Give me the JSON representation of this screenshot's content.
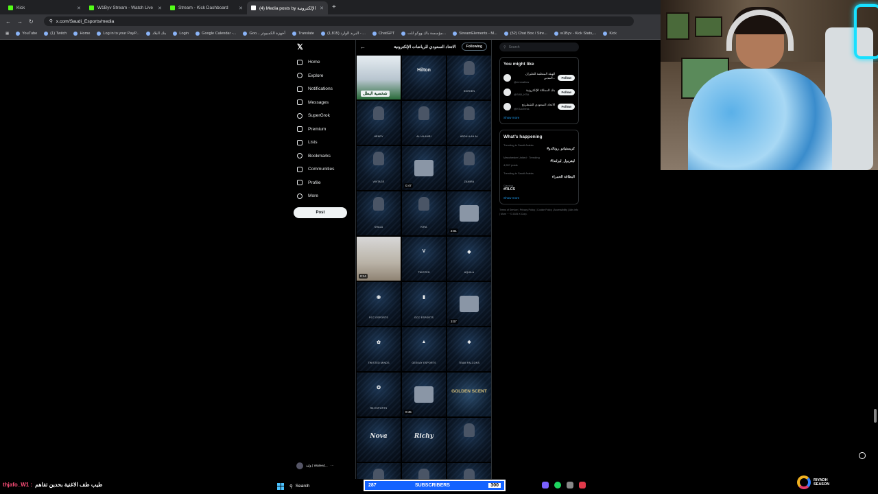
{
  "tabs": [
    {
      "title": "Kick",
      "color": "#53fc18"
    },
    {
      "title": "W1Byv Stream - Watch Live on",
      "color": "#53fc18"
    },
    {
      "title": "Stream - Kick Dashboard",
      "color": "#53fc18"
    },
    {
      "title": "(4) Media posts by الاتحاد السعودي للرياضات الإلكترونية",
      "color": "#ffffff",
      "active": true
    }
  ],
  "address": {
    "url": "x.com/Saudi_Esports/media"
  },
  "bookmarks": [
    "YouTube",
    "(1) Twitch",
    "Home",
    "Log in to your PayP...",
    "بنك البلاد",
    "Login",
    "Google Calendar -...",
    "Goo... أجهزة الكمبيوتر",
    "Translate",
    "(1,815) البريد الوارد - ...",
    "ChatGPT",
    "مؤسسة باك ووكو للت...",
    "StreamElements - M...",
    "(52) Chat Box / Stre...",
    "w1Byv - Kick Stats,...",
    "Kick"
  ],
  "nav": {
    "items": [
      "Home",
      "Explore",
      "Notifications",
      "Messages",
      "SuperGrok",
      "Premium",
      "Lists",
      "Bookmarks",
      "Communities",
      "Profile",
      "More"
    ],
    "post_label": "Post",
    "account": "وليد | Waleed..."
  },
  "media": {
    "header_name": "الاتحاد السعودي للرياضات الإلكترونية",
    "following_label": "Following",
    "tiles": [
      {
        "type": "hero",
        "caption": "شخصية البطل"
      },
      {
        "type": "logo",
        "logo": "Hilton"
      },
      {
        "type": "portrait",
        "label": "SORKEN"
      },
      {
        "type": "portrait",
        "label": "HENRY"
      },
      {
        "type": "portrait",
        "label": "ALI ALAMRI"
      },
      {
        "type": "portrait",
        "label": "ABDULLAH AL"
      },
      {
        "type": "portrait",
        "label": "VINTAGE"
      },
      {
        "type": "trophy",
        "duration": "0:47"
      },
      {
        "type": "portrait",
        "label": "ZAMIRA"
      },
      {
        "type": "portrait",
        "label": "SHALA"
      },
      {
        "type": "portrait",
        "label": "KIRA"
      },
      {
        "type": "trophy",
        "duration": "2:01"
      },
      {
        "type": "photo",
        "duration": "0:14"
      },
      {
        "type": "logo",
        "logo": "V",
        "label": "TWISTED"
      },
      {
        "type": "logo",
        "logo": "◆",
        "label": "AQUILA"
      },
      {
        "type": "logo",
        "logo": "◉",
        "label": "PCC ESPORTS"
      },
      {
        "type": "logo",
        "logo": "▮",
        "label": "GCC ESPORTS"
      },
      {
        "type": "trophy",
        "duration": "3:07"
      },
      {
        "type": "logo",
        "logo": "✿",
        "label": "TWISTED MINDS"
      },
      {
        "type": "logo",
        "logo": "▲",
        "label": "GEEKAY ESPORTS"
      },
      {
        "type": "logo",
        "logo": "❖",
        "label": "TEAM FALCONS"
      },
      {
        "type": "logo",
        "logo": "✪",
        "label": "R8 ESPORTS"
      },
      {
        "type": "trophy",
        "duration": "0:45"
      },
      {
        "type": "gold",
        "logo": "GOLDEN SCENT"
      },
      {
        "type": "script",
        "logo": "Nova"
      },
      {
        "type": "script",
        "logo": "Richy"
      },
      {
        "type": "portrait",
        "label": ""
      },
      {
        "type": "portrait",
        "label": ""
      },
      {
        "type": "portrait",
        "label": ""
      },
      {
        "type": "portrait",
        "label": ""
      }
    ]
  },
  "sidebar": {
    "search_placeholder": "Search",
    "might_like_title": "You might like",
    "suggestions": [
      {
        "name": "الهيئة المنظمة للطيران المدني...",
        "handle": "@emmaflow"
      },
      {
        "name": "بنك المملكة الإلكترونية",
        "handle": "@SAB_KSA"
      },
      {
        "name": "الاتحاد السعودي للشطرنج",
        "handle": "@KSAchess"
      }
    ],
    "follow_label": "Follow",
    "show_more": "Show more",
    "happening_title": "What’s happening",
    "trends": [
      {
        "context": "Trending in Saudi Arabia",
        "title": "#كريستيانو_رونالدو",
        "rtl": true
      },
      {
        "context": "Manchester United · Trending",
        "title": "#ليفربول_ليرلندا",
        "rtl": true,
        "posts": "4,597 posts"
      },
      {
        "context": "Trending in Saudi Arabia",
        "title": "البطاقة الحمراء",
        "rtl": true
      },
      {
        "context": "Gaming",
        "title": "#RLCS",
        "rtl": false
      }
    ],
    "footer": "Terms of Service | Privacy Policy | Cookie Policy | Accessibility | Ads info | More ··· © 2025 X Corp."
  },
  "overlay": {
    "chat_user": "thjafo_W1 :",
    "chat_message": "طيب طف الاغنية بحدين تفاهم",
    "search_label": "Search",
    "sub_count": "287",
    "sub_label": "SUBSCRIBERS",
    "sub_goal": "300",
    "sponsor_line1": "RIYADH",
    "sponsor_line2": "SEASON"
  }
}
